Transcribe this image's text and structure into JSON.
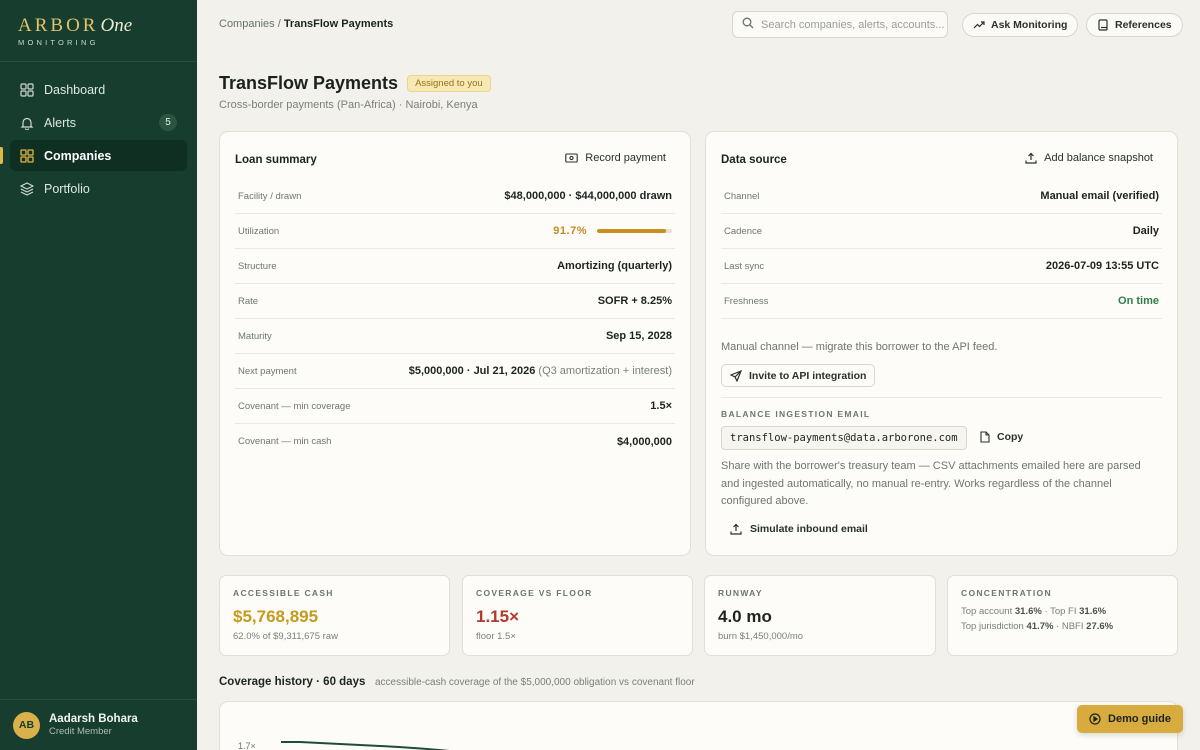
{
  "brand": {
    "name": "ARBOR",
    "one": "One",
    "sub": "MONITORING"
  },
  "sidebar": {
    "items": [
      {
        "label": "Dashboard",
        "icon": "grid-icon"
      },
      {
        "label": "Alerts",
        "icon": "bell-icon",
        "badge": "5"
      },
      {
        "label": "Companies",
        "icon": "building-icon",
        "active": true
      },
      {
        "label": "Portfolio",
        "icon": "layers-icon"
      }
    ],
    "user": {
      "initials": "AB",
      "name": "Aadarsh Bohara",
      "role": "Credit Member"
    }
  },
  "topbar": {
    "breadcrumb_parent": "Companies",
    "breadcrumb_sep": " / ",
    "breadcrumb_current": "TransFlow Payments",
    "search_placeholder": "Search companies, alerts, accounts...",
    "ask_label": "Ask Monitoring",
    "references_label": "References"
  },
  "header": {
    "title": "TransFlow Payments",
    "badge": "Assigned to you",
    "subtitle": "Cross-border payments (Pan-Africa) · Nairobi, Kenya"
  },
  "loan": {
    "title": "Loan summary",
    "action": "Record payment",
    "rows": {
      "facility": {
        "k": "Facility / drawn",
        "v": "$48,000,000 · $44,000,000 drawn"
      },
      "utilization": {
        "k": "Utilization",
        "v": "91.7%",
        "fraction": 0.917
      },
      "structure": {
        "k": "Structure",
        "v": "Amortizing (quarterly)"
      },
      "rate": {
        "k": "Rate",
        "v": "SOFR + 8.25%"
      },
      "maturity": {
        "k": "Maturity",
        "v": "Sep 15, 2028"
      },
      "next_payment": {
        "k": "Next payment",
        "v": "$5,000,000 · Jul 21, 2026",
        "note": "(Q3 amortization + interest)"
      },
      "cov_coverage": {
        "k": "Covenant — min coverage",
        "v": "1.5×"
      },
      "cov_cash": {
        "k": "Covenant — min cash",
        "v": "$4,000,000"
      }
    }
  },
  "datasource": {
    "title": "Data source",
    "action": "Add balance snapshot",
    "rows": {
      "channel": {
        "k": "Channel",
        "v": "Manual email (verified)"
      },
      "cadence": {
        "k": "Cadence",
        "v": "Daily"
      },
      "last_sync": {
        "k": "Last sync",
        "v": "2026-07-09 13:55 UTC"
      },
      "freshness": {
        "k": "Freshness",
        "v": "On time"
      }
    },
    "note": "Manual channel — migrate this borrower to the API feed.",
    "invite_label": "Invite to API integration",
    "email_heading": "BALANCE INGESTION EMAIL",
    "email": "transflow-payments@data.arborone.com",
    "copy_label": "Copy",
    "description": "Share with the borrower's treasury team — CSV attachments emailed here are parsed and ingested automatically, no manual re-entry. Works regardless of the channel configured above.",
    "simulate_label": "Simulate inbound email"
  },
  "metrics": {
    "cash": {
      "label": "ACCESSIBLE CASH",
      "value": "$5,768,895",
      "sub": "62.0% of $9,311,675 raw",
      "color": "#c59a1f"
    },
    "coverage": {
      "label": "COVERAGE VS FLOOR",
      "value": "1.15×",
      "sub": "floor 1.5×",
      "color": "#b23a2e"
    },
    "runway": {
      "label": "RUNWAY",
      "value": "4.0 mo",
      "sub": "burn $1,450,000/mo",
      "color": "#1d2420"
    },
    "concentration": {
      "label": "CONCENTRATION",
      "line1_a": "Top account ",
      "line1_b": "31.6%",
      "line1_c": " · Top FI ",
      "line1_d": "31.6%",
      "line2_a": "Top jurisdiction ",
      "line2_b": "41.7%",
      "line2_c": " · NBFI ",
      "line2_d": "27.6%"
    }
  },
  "coverage_history": {
    "title": "Coverage history · 60 days",
    "subtitle": "accessible-cash coverage of the $5,000,000 obligation vs covenant floor",
    "y_tick_top": "1.7×",
    "line_color": "#1f4d39"
  },
  "demo_label": "Demo guide",
  "colors": {
    "sidebar": "#163d2d",
    "accent": "#d8ab3e"
  }
}
